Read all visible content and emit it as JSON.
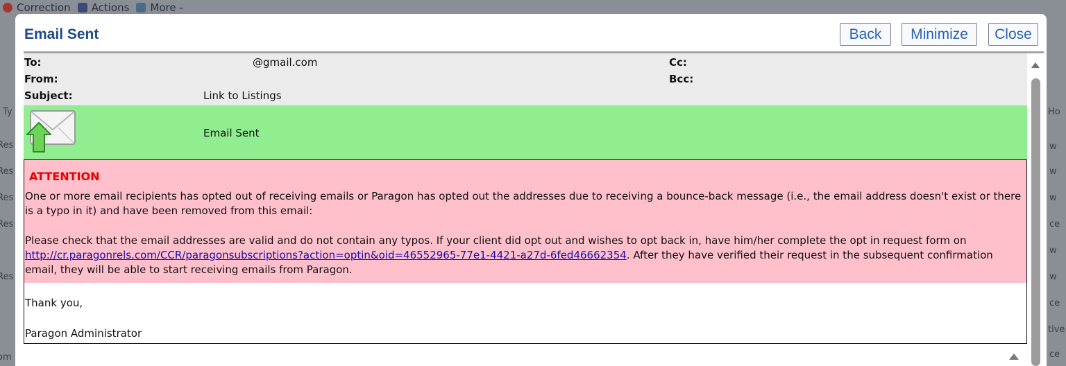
{
  "background": {
    "toolbar": [
      "Correction",
      "Actions",
      "More -"
    ],
    "left_cells": [
      "",
      "",
      "o Ty",
      "Res",
      "Res",
      "Res",
      "Res",
      "Res",
      "om"
    ],
    "right_cells": [
      "Ho",
      "w",
      "w",
      "w",
      "ce",
      "w",
      "w",
      "ce",
      "tive",
      "ce"
    ]
  },
  "dialog": {
    "title": "Email Sent",
    "buttons": {
      "back": "Back",
      "minimize": "Minimize",
      "close": "Close"
    }
  },
  "header": {
    "to_label": "To:",
    "to_value": "@gmail.com",
    "from_label": "From:",
    "from_value": "",
    "subject_label": "Subject:",
    "subject_value": "Link to Listings",
    "cc_label": "Cc:",
    "cc_value": "",
    "bcc_label": "Bcc:",
    "bcc_value": ""
  },
  "status": {
    "icon": "envelope-sent-icon",
    "text": "Email Sent"
  },
  "attention": {
    "title": "ATTENTION",
    "p1": "One or more email recipients has opted out of receiving emails or Paragon has opted out the addresses due to receiving a bounce-back message (i.e., the email address doesn't exist or there is a typo in it) and have been removed from this email:",
    "p2_before": "Please check that the email addresses are valid and do not contain any typos. If your client did opt out and wishes to opt back in, have him/her complete the opt in request form on ",
    "link": "http://cr.paragonrels.com/CCR/paragonsubscriptions?action=optin&oid=46552965-77e1-4421-a27d-6fed46662354",
    "p2_after": ". After they have verified their request in the subsequent confirmation email, they will be able to start receiving emails from Paragon."
  },
  "closing": {
    "thanks": "Thank you,",
    "signature": "Paragon Administrator"
  },
  "colors": {
    "title": "#1e4a86",
    "button_text": "#2a63b4",
    "sent_bg": "#90ee90",
    "attention_bg": "#ffc0cb",
    "attention_title": "#e60000"
  }
}
